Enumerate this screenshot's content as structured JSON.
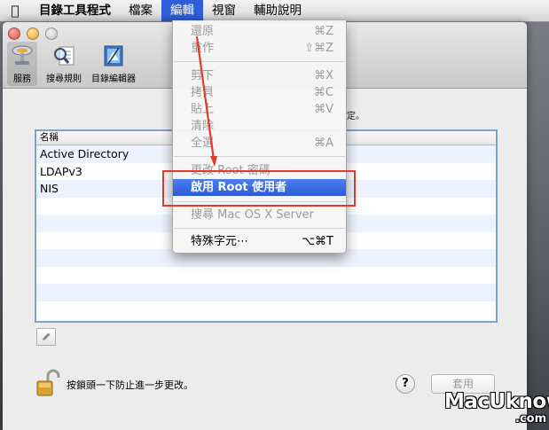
{
  "menubar": {
    "app_name": "目錄工具程式",
    "items": [
      "檔案",
      "編輯",
      "視窗",
      "輔助說明"
    ]
  },
  "toolbar": {
    "items": [
      {
        "label": "服務",
        "icon": "services-icon"
      },
      {
        "label": "搜尋規則",
        "icon": "search-policy-icon"
      },
      {
        "label": "目錄編輯器",
        "icon": "directory-editor-icon"
      }
    ]
  },
  "main": {
    "desc_end": "定。",
    "table": {
      "header": "名稱",
      "rows": [
        "Active Directory",
        "LDAPv3",
        "NIS"
      ]
    },
    "lock_text": "按鎖頭一下防止進一步更改。",
    "help_label": "?",
    "apply_label": "套用"
  },
  "edit_menu": {
    "items": [
      {
        "label": "還原",
        "shortcut": "⌘Z",
        "enabled": false
      },
      {
        "label": "重作",
        "shortcut": "⇧⌘Z",
        "enabled": false
      },
      {
        "label": "剪下",
        "shortcut": "⌘X",
        "enabled": false
      },
      {
        "label": "拷貝",
        "shortcut": "⌘C",
        "enabled": false
      },
      {
        "label": "貼上",
        "shortcut": "⌘V",
        "enabled": false
      },
      {
        "label": "清除",
        "shortcut": "",
        "enabled": false
      },
      {
        "label": "全選",
        "shortcut": "⌘A",
        "enabled": false
      },
      {
        "label": "更改 Root 密碼",
        "shortcut": "",
        "enabled": false
      },
      {
        "label": "啟用 Root 使用者",
        "shortcut": "",
        "enabled": true,
        "highlighted": true
      },
      {
        "label": "搜尋 Mac OS X Server",
        "shortcut": "",
        "enabled": false
      },
      {
        "label": "特殊字元⋯",
        "shortcut": "⌥⌘T",
        "enabled": true
      }
    ]
  },
  "watermark": {
    "main": "MacUknow",
    "sub": ".com"
  },
  "colors": {
    "highlight": "#2f5fd8",
    "annotation": "#e23a2a"
  }
}
